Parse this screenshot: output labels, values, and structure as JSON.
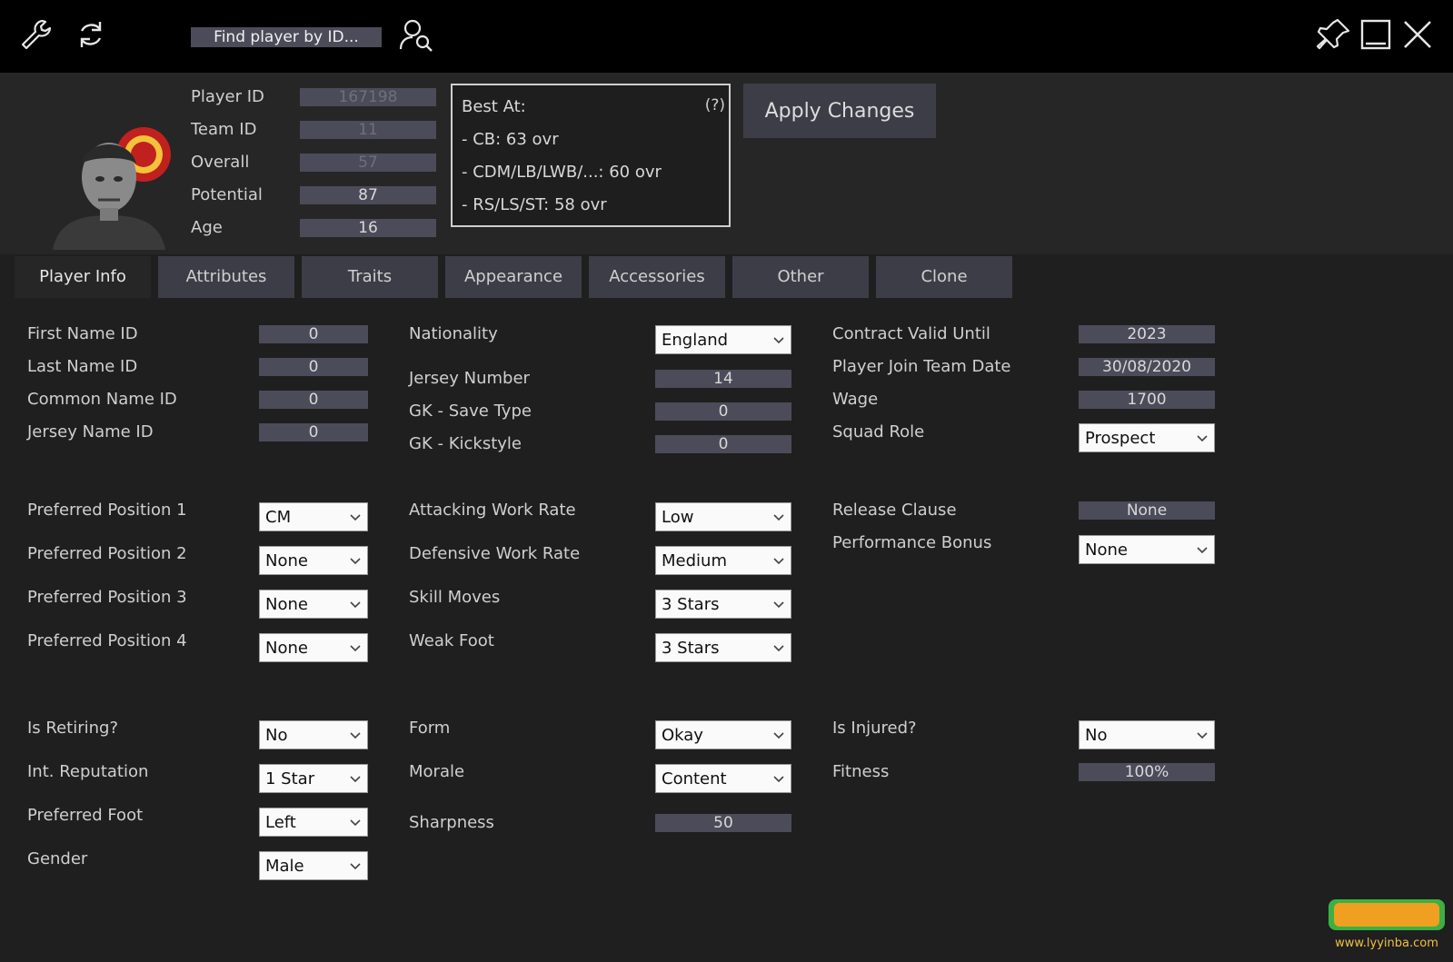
{
  "toolbar": {
    "find_player_label": "Find player by ID...",
    "icons": [
      "wrench-icon",
      "refresh-icon",
      "search-player-icon",
      "pin-icon",
      "minimize-icon",
      "close-icon"
    ]
  },
  "header": {
    "player_id_label": "Player ID",
    "player_id": "167198",
    "team_id_label": "Team ID",
    "team_id": "11",
    "overall_label": "Overall",
    "overall": "57",
    "potential_label": "Potential",
    "potential": "87",
    "age_label": "Age",
    "age": "16",
    "best_at_title": "Best At:",
    "best_at_help": "(?)",
    "best_at": [
      "- CB: 63 ovr",
      "- CDM/LB/LWB/...: 60 ovr",
      "- RS/LS/ST: 58 ovr"
    ],
    "apply_label": "Apply Changes"
  },
  "tabs": [
    "Player Info",
    "Attributes",
    "Traits",
    "Appearance",
    "Accessories",
    "Other",
    "Clone"
  ],
  "col1": {
    "first_name_id_label": "First Name ID",
    "first_name_id": "0",
    "last_name_id_label": "Last Name ID",
    "last_name_id": "0",
    "common_name_id_label": "Common Name ID",
    "common_name_id": "0",
    "jersey_name_id_label": "Jersey Name ID",
    "jersey_name_id": "0",
    "pref_pos1_label": "Preferred Position 1",
    "pref_pos1": "CM",
    "pref_pos2_label": "Preferred Position 2",
    "pref_pos2": "None",
    "pref_pos3_label": "Preferred Position 3",
    "pref_pos3": "None",
    "pref_pos4_label": "Preferred Position 4",
    "pref_pos4": "None",
    "is_retiring_label": "Is Retiring?",
    "is_retiring": "No",
    "int_rep_label": "Int. Reputation",
    "int_rep": "1 Star",
    "pref_foot_label": "Preferred Foot",
    "pref_foot": "Left",
    "gender_label": "Gender",
    "gender": "Male"
  },
  "col2": {
    "nationality_label": "Nationality",
    "nationality": "England",
    "jersey_number_label": "Jersey Number",
    "jersey_number": "14",
    "gk_save_label": "GK - Save Type",
    "gk_save": "0",
    "gk_kick_label": "GK - Kickstyle",
    "gk_kick": "0",
    "att_wr_label": "Attacking Work Rate",
    "att_wr": "Low",
    "def_wr_label": "Defensive Work Rate",
    "def_wr": "Medium",
    "skill_label": "Skill Moves",
    "skill": "3 Stars",
    "weak_foot_label": "Weak Foot",
    "weak_foot": "3 Stars",
    "form_label": "Form",
    "form": "Okay",
    "morale_label": "Morale",
    "morale": "Content",
    "sharpness_label": "Sharpness",
    "sharpness": "50"
  },
  "col3": {
    "contract_label": "Contract Valid Until",
    "contract": "2023",
    "join_date_label": "Player Join Team Date",
    "join_date": "30/08/2020",
    "wage_label": "Wage",
    "wage": "1700",
    "squad_role_label": "Squad Role",
    "squad_role": "Prospect",
    "release_label": "Release Clause",
    "release": "None",
    "perf_bonus_label": "Performance Bonus",
    "perf_bonus": "None",
    "injured_label": "Is Injured?",
    "injured": "No",
    "fitness_label": "Fitness",
    "fitness": "100%"
  },
  "watermark": {
    "text": "www.lyyinba.com",
    "colors": {
      "green": "#3cb043",
      "orange": "#f0a020"
    }
  }
}
